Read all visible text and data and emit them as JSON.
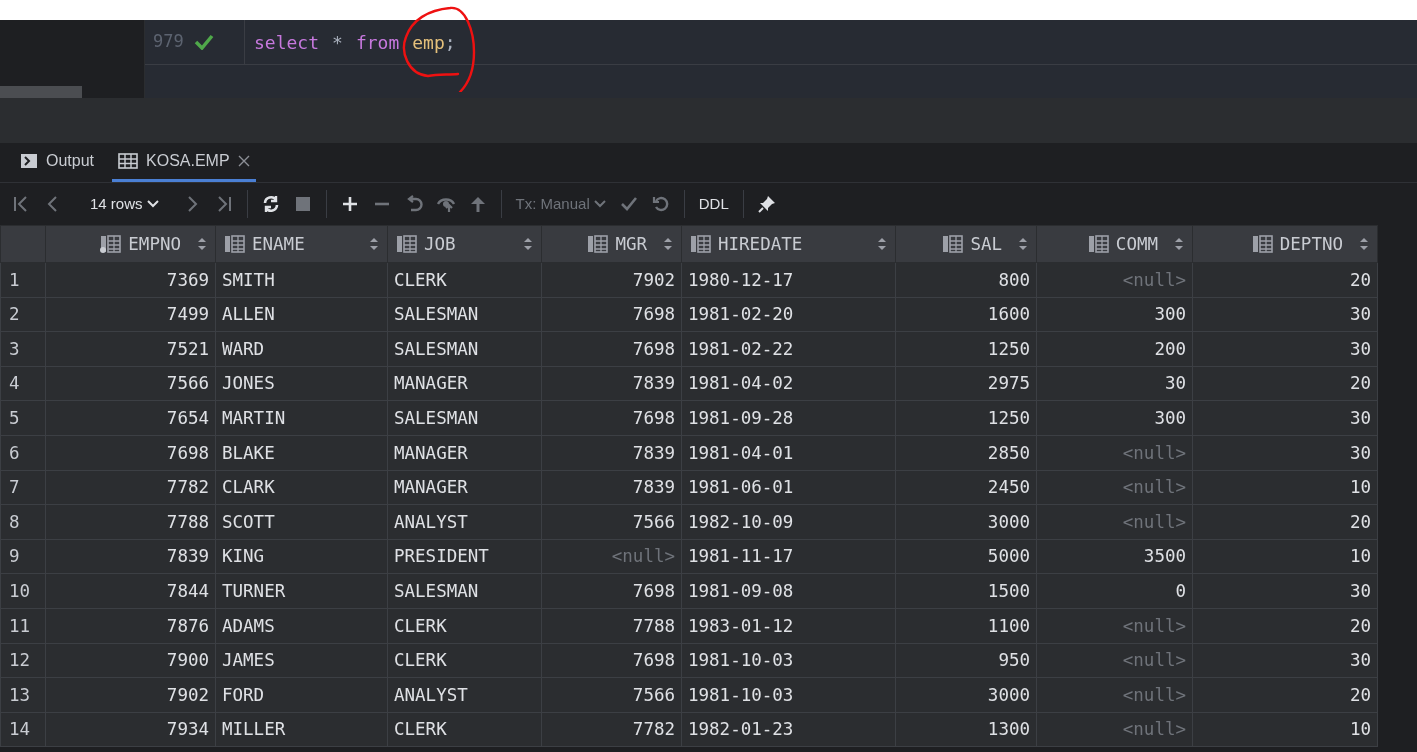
{
  "editor": {
    "line_number": "979",
    "executed": true,
    "code": [
      {
        "kind": "keyword",
        "text": "select"
      },
      {
        "kind": "operator",
        "text": "*"
      },
      {
        "kind": "keyword",
        "text": "from"
      },
      {
        "kind": "identifier",
        "text": "emp"
      },
      {
        "kind": "punct",
        "text": ";"
      }
    ]
  },
  "tabs": [
    {
      "label": "Output",
      "kind": "console",
      "selected": false,
      "closable": false
    },
    {
      "label": "KOSA.EMP",
      "kind": "table",
      "selected": true,
      "closable": true
    }
  ],
  "toolbar": [
    {
      "kind": "first",
      "disabled": true
    },
    {
      "kind": "prev",
      "disabled": true
    },
    {
      "kind": "rows",
      "label": "14 rows",
      "disabled": false
    },
    {
      "kind": "next",
      "disabled": true
    },
    {
      "kind": "last",
      "disabled": true
    },
    {
      "kind": "sep"
    },
    {
      "kind": "refresh",
      "disabled": false
    },
    {
      "kind": "stop",
      "disabled": true
    },
    {
      "kind": "sep"
    },
    {
      "kind": "add",
      "disabled": false
    },
    {
      "kind": "remove",
      "disabled": true
    },
    {
      "kind": "revert",
      "disabled": true
    },
    {
      "kind": "preview",
      "disabled": true
    },
    {
      "kind": "submit",
      "disabled": true
    },
    {
      "kind": "sep"
    },
    {
      "kind": "tx",
      "label": "Tx: Manual",
      "disabled": true
    },
    {
      "kind": "commit",
      "disabled": true
    },
    {
      "kind": "rollback",
      "disabled": true
    },
    {
      "kind": "sep"
    },
    {
      "kind": "ddl",
      "label": "DDL",
      "disabled": false
    },
    {
      "kind": "sep"
    },
    {
      "kind": "pin",
      "disabled": false
    }
  ],
  "table": {
    "columns": [
      {
        "name": "EMPNO",
        "primary_key": true,
        "kind": "numeric"
      },
      {
        "name": "ENAME",
        "primary_key": false,
        "kind": "text"
      },
      {
        "name": "JOB",
        "primary_key": false,
        "kind": "text"
      },
      {
        "name": "MGR",
        "primary_key": false,
        "kind": "numeric"
      },
      {
        "name": "HIREDATE",
        "primary_key": false,
        "kind": "text"
      },
      {
        "name": "SAL",
        "primary_key": false,
        "kind": "numeric"
      },
      {
        "name": "COMM",
        "primary_key": false,
        "kind": "numeric"
      },
      {
        "name": "DEPTNO",
        "primary_key": false,
        "kind": "numeric"
      }
    ],
    "rows": [
      {
        "number": "1",
        "cells": [
          "7369",
          "SMITH",
          "CLERK",
          "7902",
          "1980-12-17",
          "800",
          {
            "text": "<null>",
            "is_null": true
          },
          "20"
        ]
      },
      {
        "number": "2",
        "cells": [
          "7499",
          "ALLEN",
          "SALESMAN",
          "7698",
          "1981-02-20",
          "1600",
          "300",
          "30"
        ]
      },
      {
        "number": "3",
        "cells": [
          "7521",
          "WARD",
          "SALESMAN",
          "7698",
          "1981-02-22",
          "1250",
          "200",
          "30"
        ]
      },
      {
        "number": "4",
        "cells": [
          "7566",
          "JONES",
          "MANAGER",
          "7839",
          "1981-04-02",
          "2975",
          "30",
          "20"
        ]
      },
      {
        "number": "5",
        "cells": [
          "7654",
          "MARTIN",
          "SALESMAN",
          "7698",
          "1981-09-28",
          "1250",
          "300",
          "30"
        ]
      },
      {
        "number": "6",
        "cells": [
          "7698",
          "BLAKE",
          "MANAGER",
          "7839",
          "1981-04-01",
          "2850",
          {
            "text": "<null>",
            "is_null": true
          },
          "30"
        ]
      },
      {
        "number": "7",
        "cells": [
          "7782",
          "CLARK",
          "MANAGER",
          "7839",
          "1981-06-01",
          "2450",
          {
            "text": "<null>",
            "is_null": true
          },
          "10"
        ]
      },
      {
        "number": "8",
        "cells": [
          "7788",
          "SCOTT",
          "ANALYST",
          "7566",
          "1982-10-09",
          "3000",
          {
            "text": "<null>",
            "is_null": true
          },
          "20"
        ]
      },
      {
        "number": "9",
        "cells": [
          "7839",
          "KING",
          "PRESIDENT",
          {
            "text": "<null>",
            "is_null": true
          },
          "1981-11-17",
          "5000",
          "3500",
          "10"
        ]
      },
      {
        "number": "10",
        "cells": [
          "7844",
          "TURNER",
          "SALESMAN",
          "7698",
          "1981-09-08",
          "1500",
          "0",
          "30"
        ]
      },
      {
        "number": "11",
        "cells": [
          "7876",
          "ADAMS",
          "CLERK",
          "7788",
          "1983-01-12",
          "1100",
          {
            "text": "<null>",
            "is_null": true
          },
          "20"
        ]
      },
      {
        "number": "12",
        "cells": [
          "7900",
          "JAMES",
          "CLERK",
          "7698",
          "1981-10-03",
          "950",
          {
            "text": "<null>",
            "is_null": true
          },
          "30"
        ]
      },
      {
        "number": "13",
        "cells": [
          "7902",
          "FORD",
          "ANALYST",
          "7566",
          "1981-10-03",
          "3000",
          {
            "text": "<null>",
            "is_null": true
          },
          "20"
        ]
      },
      {
        "number": "14",
        "cells": [
          "7934",
          "MILLER",
          "CLERK",
          "7782",
          "1982-01-23",
          "1300",
          {
            "text": "<null>",
            "is_null": true
          },
          "10"
        ]
      }
    ]
  }
}
